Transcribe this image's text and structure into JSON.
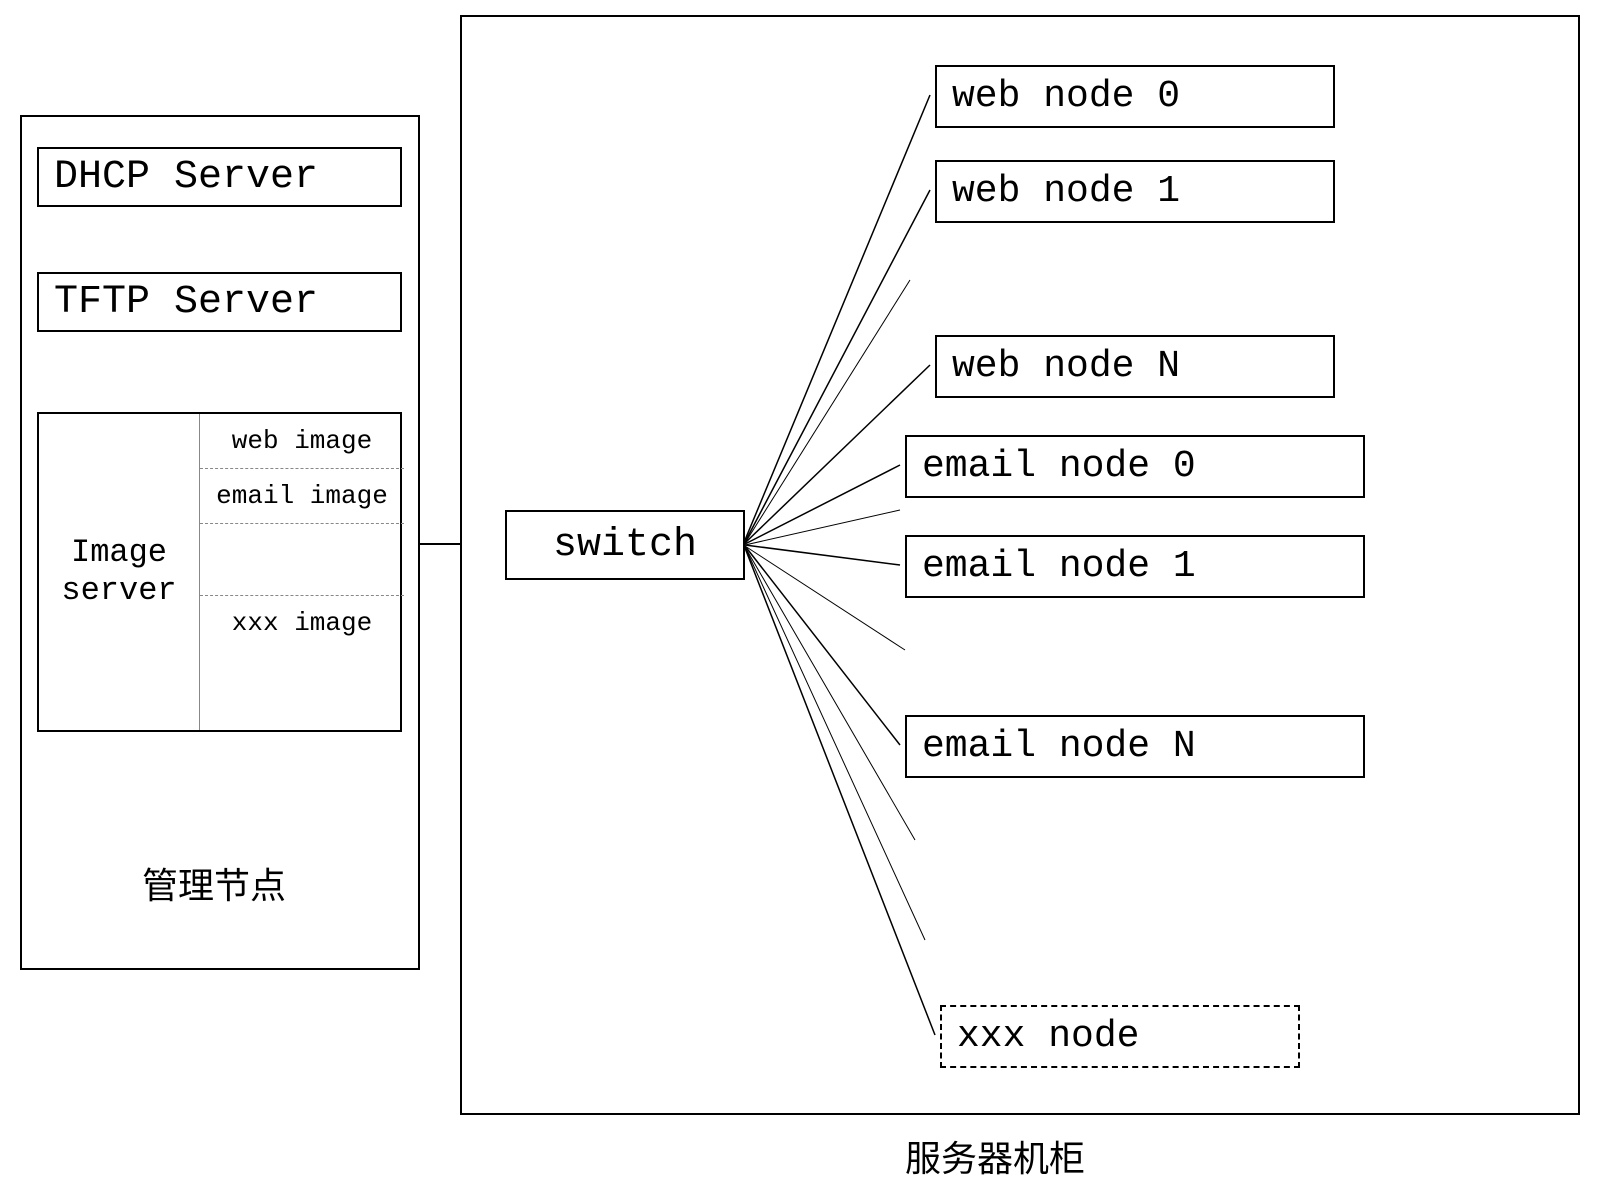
{
  "mgmt": {
    "dhcp": "DHCP Server",
    "tftp": "TFTP Server",
    "image_server_label_line1": "Image",
    "image_server_label_line2": "server",
    "images": {
      "web": "web image",
      "email": "email image",
      "xxx": "xxx image"
    },
    "label": "管理节点"
  },
  "switch_label": "switch",
  "nodes": {
    "web0": "web node 0",
    "web1": "web node 1",
    "webN": "web node N",
    "email0": "email node 0",
    "email1": "email node 1",
    "emailN": "email node N",
    "xxx": "xxx node"
  },
  "cabinet_label": "服务器机柜"
}
